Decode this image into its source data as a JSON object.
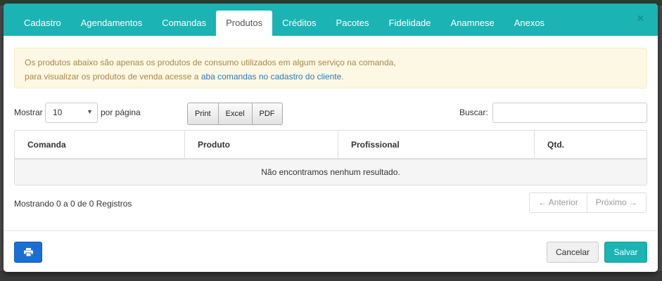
{
  "tabs": [
    "Cadastro",
    "Agendamentos",
    "Comandas",
    "Produtos",
    "Créditos",
    "Pacotes",
    "Fidelidade",
    "Anamnese",
    "Anexos"
  ],
  "active_tab": "Produtos",
  "close_symbol": "×",
  "alert": {
    "line1": "Os produtos abaixo são apenas os produtos de consumo utilizados em algum serviço na comanda,",
    "line2_prefix": "para visualizar os produtos de venda acesse a ",
    "line2_link": "aba comandas no cadastro do cliente",
    "line2_suffix": "."
  },
  "controls": {
    "show_label": "Mostrar",
    "page_size": "10",
    "per_page_label": "por página",
    "export_buttons": [
      "Print",
      "Excel",
      "PDF"
    ],
    "search_label": "Buscar:",
    "search_value": ""
  },
  "table": {
    "columns": [
      "Comanda",
      "Produto",
      "Profissional",
      "Qtd."
    ],
    "empty_message": "Não encontramos nenhum resultado."
  },
  "info": "Mostrando 0 a 0 de 0 Registros",
  "pagination": {
    "previous": "← Anterior",
    "next": "Próximo →"
  },
  "footer": {
    "print_icon": "printer-icon",
    "cancel": "Cancelar",
    "save": "Salvar"
  },
  "colors": {
    "header": "#1bb3b3",
    "primary": "#1a6fd6",
    "alert_bg": "#fcf8e3",
    "alert_text": "#a9874a"
  }
}
